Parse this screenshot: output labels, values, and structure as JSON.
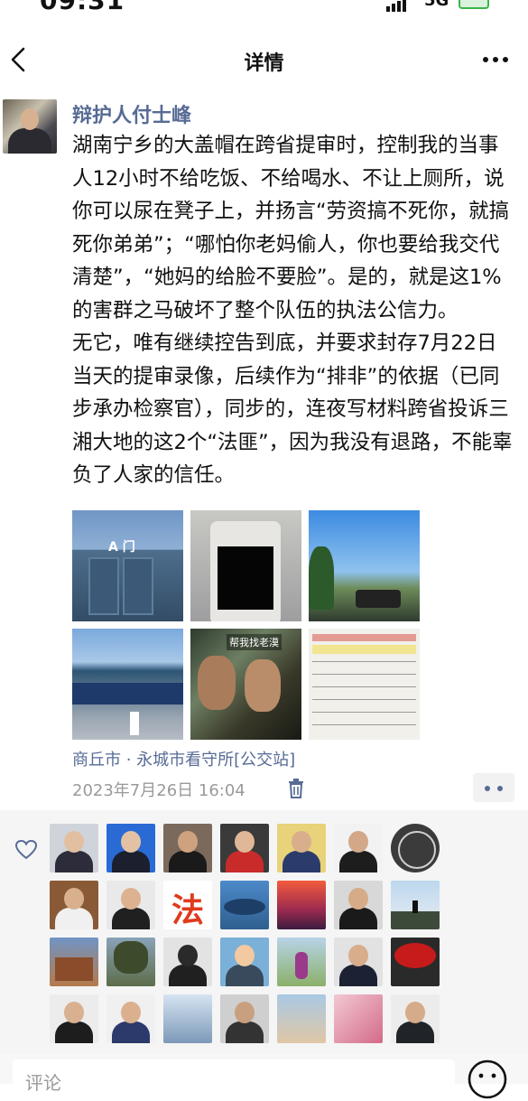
{
  "status_bar": {
    "time": "09:31",
    "network": "5G"
  },
  "nav": {
    "title": "详情",
    "back_icon": "chevron-left-icon",
    "more_icon": "more-dots-icon"
  },
  "post": {
    "author": "辩护人付士峰",
    "text": "湖南宁乡的大盖帽在跨省提审时，控制我的当事人12小时不给吃饭、不给喝水、不让上厕所，说你可以尿在凳子上，并扬言“劳资搞不死你，就搞死你弟弟”；“哪怕你老妈偷人，你也要给我交代清楚”，“她妈的给脸不要脸”。是的，就是这1%的害群之马破坏了整个队伍的执法公信力。\n无它，唯有继续控告到底，并要求封存7月22日当天的提审录像，后续作为“排非”的依据（已同步承办检察官），同步的，连夜写材料跨省投诉三湘大地的这2个“法匪”，因为我没有退路，不能辜负了人家的信任。",
    "photo_captions": {
      "p1_sign": "A 门",
      "p5_caption": "帮我找老漠"
    },
    "location": "商丘市 · 永城市看守所[公交站]",
    "timestamp": "2023年7月26日 16:04"
  },
  "likes": {
    "icon": "heart-outline-icon",
    "fa_tile": "法"
  },
  "comment_bar": {
    "placeholder": "评论",
    "emoji_icon": "smiley-icon"
  },
  "colors": {
    "link": "#576b95",
    "muted": "#9a9a9a",
    "panel": "#f5f5f5"
  }
}
